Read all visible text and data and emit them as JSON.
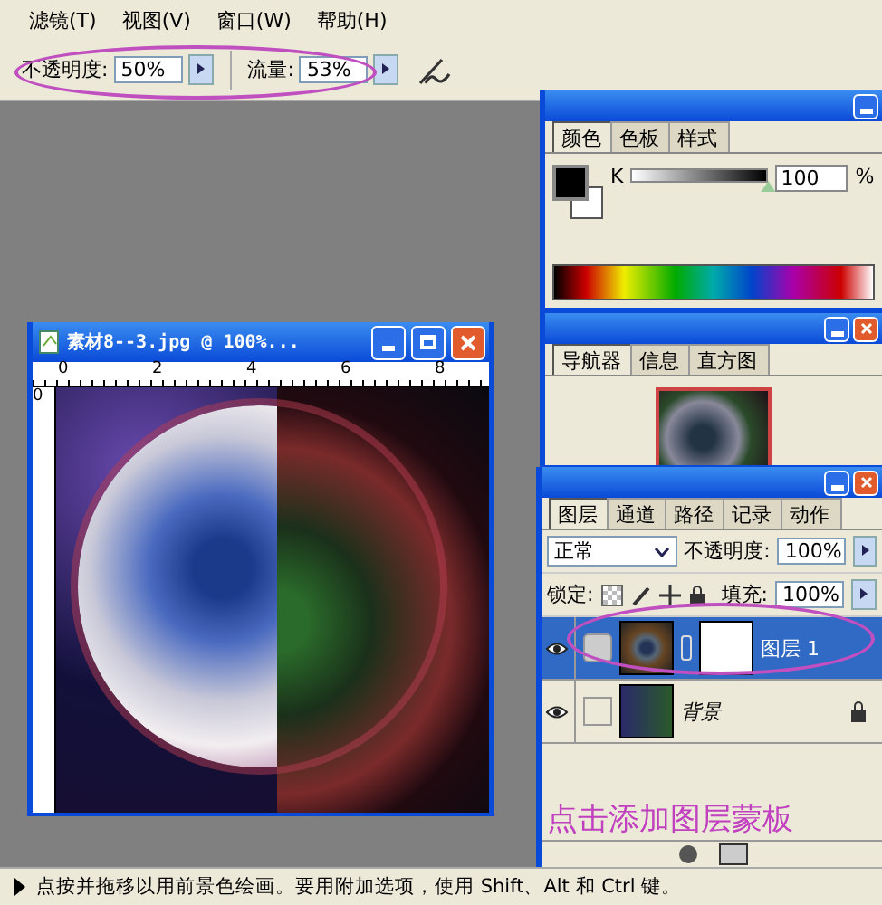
{
  "menu": [
    {
      "label": "滤镜(T)"
    },
    {
      "label": "视图(V)"
    },
    {
      "label": "窗口(W)"
    },
    {
      "label": "帮助(H)"
    }
  ],
  "options": {
    "opacity_label": "不透明度:",
    "opacity": "50%",
    "flow_label": "流量:",
    "flow": "53%"
  },
  "document": {
    "title": "素材8--3.jpg @ 100%...",
    "ruler_marks": [
      "0",
      "2",
      "4",
      "6",
      "8"
    ],
    "ruler_v": "0"
  },
  "color_panel": {
    "tabs": [
      {
        "label": "颜色",
        "selected": true
      },
      {
        "label": "色板",
        "selected": false
      },
      {
        "label": "样式",
        "selected": false
      }
    ],
    "channel": "K",
    "level": 1,
    "value": "100",
    "unit": "%"
  },
  "navigator_panel": {
    "tabs": [
      {
        "label": "导航器",
        "selected": true
      },
      {
        "label": "信息",
        "selected": false
      },
      {
        "label": "直方图",
        "selected": false
      }
    ]
  },
  "layers_panel": {
    "tabs": [
      {
        "label": "图层",
        "selected": true
      },
      {
        "label": "通道",
        "selected": false
      },
      {
        "label": "路径",
        "selected": false
      },
      {
        "label": "记录",
        "selected": false
      },
      {
        "label": "动作",
        "selected": false
      }
    ],
    "blend_mode": "正常",
    "opacity_label": "不透明度:",
    "opacity": "100%",
    "lock_label": "锁定:",
    "fill_label": "填充:",
    "fill": "100%",
    "layers": [
      {
        "name": "图层 1",
        "selected": true,
        "visible": true,
        "has_mask": true,
        "locked": false
      },
      {
        "name": "背景",
        "selected": false,
        "visible": true,
        "has_mask": false,
        "locked": true
      }
    ]
  },
  "annotation": "点击添加图层蒙板",
  "status_bar": "点按并拖移以用前景色绘画。要用附加选项，使用 Shift、Alt 和 Ctrl 键。"
}
